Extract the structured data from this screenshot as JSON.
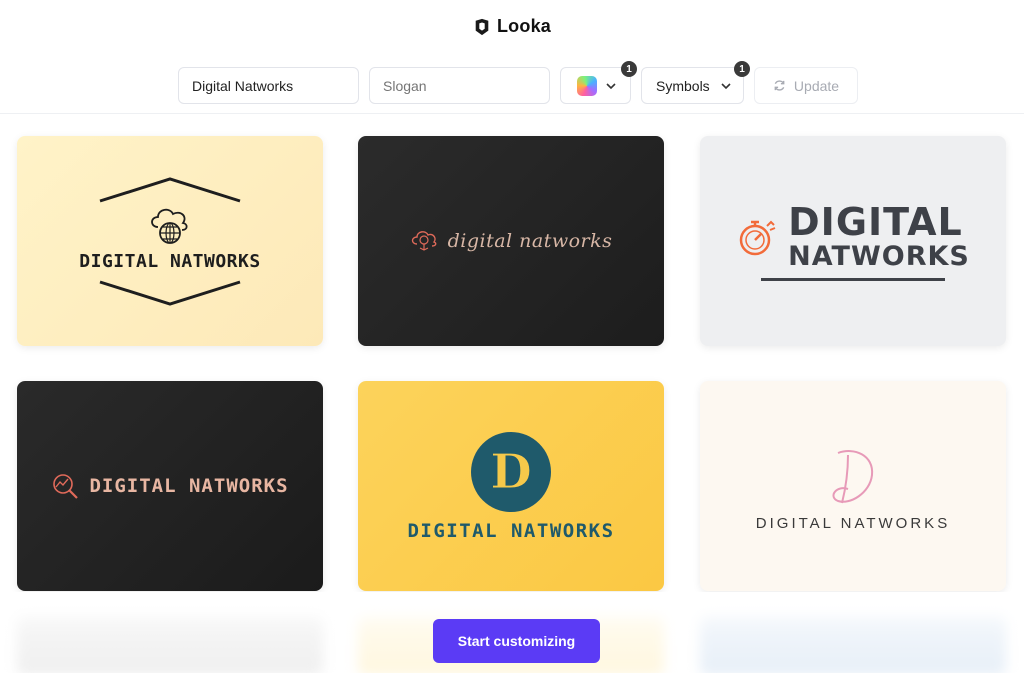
{
  "header": {
    "brand": "Looka"
  },
  "toolbar": {
    "name_value": "Digital Natworks",
    "slogan_placeholder": "Slogan",
    "colors_badge": "1",
    "symbols_label": "Symbols",
    "symbols_badge": "1",
    "update_label": "Update"
  },
  "cards": [
    {
      "text": "DIGITAL NATWORKS",
      "style": "cloud-globe-hexagon",
      "bg": "#fff3c8"
    },
    {
      "text": "digital natworks",
      "style": "cloud-dollar-script",
      "bg": "#262626"
    },
    {
      "line1": "DIGITAL",
      "line2": "NATWORKS",
      "style": "stopwatch-bold",
      "bg": "#eeeff1"
    },
    {
      "text": "DIGITAL NATWORKS",
      "style": "chart-magnifier",
      "bg": "#232323"
    },
    {
      "text": "DIGITAL NATWORKS",
      "style": "letter-badge",
      "monogram": "D",
      "bg": "#fcd35b"
    },
    {
      "text": "DIGITAL NATWORKS",
      "style": "script-monogram",
      "bg": "#fdf8f1"
    }
  ],
  "cta": {
    "label": "Start customizing"
  },
  "colors": {
    "accent": "#5b3bf5",
    "badge": "#3a3a3a",
    "teal": "#1f5a6b",
    "orange": "#f26b3a"
  }
}
